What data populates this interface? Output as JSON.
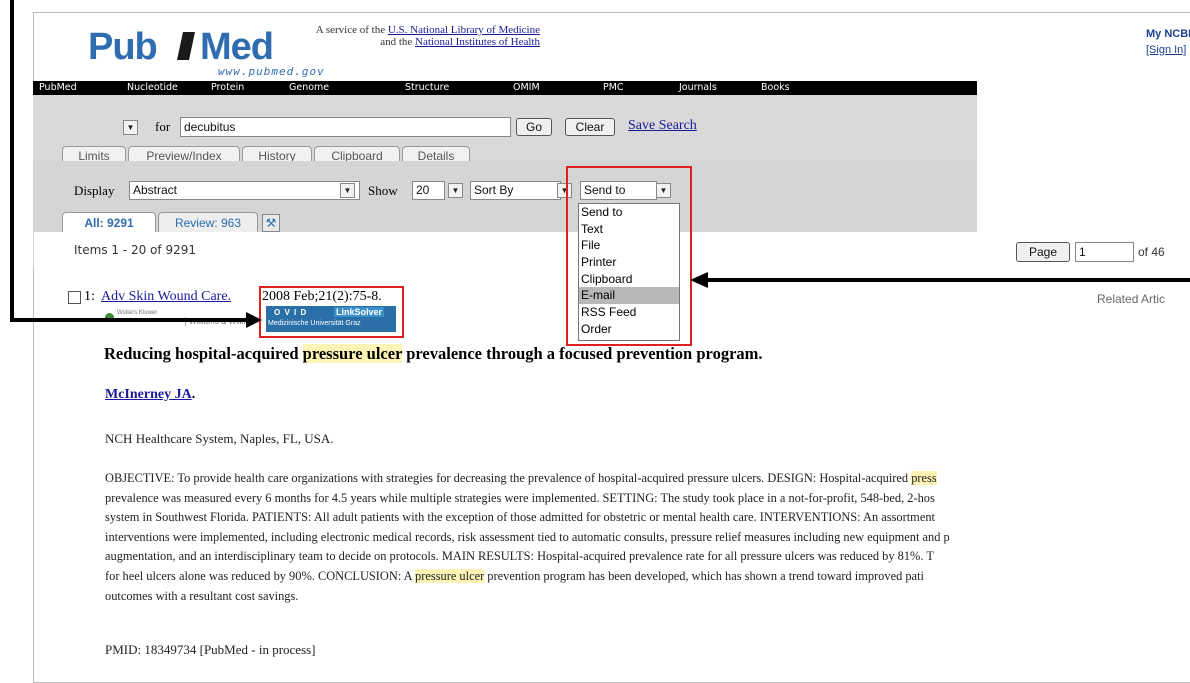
{
  "logo": {
    "pub": "Pub",
    "med": "Med",
    "www": "www.pubmed.gov"
  },
  "service": {
    "line1_prefix": "A service of the ",
    "line1_link": "U.S. National Library of Medicine",
    "line2_prefix": "and the ",
    "line2_link": "National Institutes of Health"
  },
  "account": {
    "title": "My NCBI",
    "signin": "[Sign In]"
  },
  "nav": [
    "PubMed",
    "Nucleotide",
    "Protein",
    "Genome",
    "Structure",
    "OMIM",
    "PMC",
    "Journals",
    "Books"
  ],
  "search": {
    "for_label": "for",
    "query": "decubitus",
    "go": "Go",
    "clear": "Clear",
    "save": "Save Search"
  },
  "tabs": [
    "Limits",
    "Preview/Index",
    "History",
    "Clipboard",
    "Details"
  ],
  "display": {
    "label": "Display",
    "value": "Abstract",
    "show_label": "Show",
    "show_value": "20",
    "sort": "Sort By",
    "sendto": "Send to"
  },
  "result_tabs": {
    "all": "All: 9291",
    "review": "Review: 963"
  },
  "items": "Items 1 - 20 of 9291",
  "pager": {
    "page_btn": "Page",
    "page_value": "1",
    "of": "of 46"
  },
  "sendto_menu": [
    "Send to",
    "Text",
    "File",
    "Printer",
    "Clipboard",
    "E-mail",
    "RSS Feed",
    "Order"
  ],
  "sendto_highlight": "E-mail",
  "result": {
    "number": "1:",
    "journal": "Adv Skin Wound Care.",
    "citation": "2008 Feb;21(2):75-8.",
    "related": "Related Artic",
    "publisher_logo": "Williams & Wilkins",
    "publisher_top": "Wolters Kluwer",
    "ovid": "O V I D",
    "linksolver": "LinkSolver",
    "graz": "Medizinische Universität Graz",
    "title_pre": "Reducing hospital-acquired ",
    "title_hl": "pressure ulcer",
    "title_post": " prevalence through a focused prevention program.",
    "author": "McInerney JA",
    "author_dot": ".",
    "affiliation": "NCH Healthcare System, Naples, FL, USA.",
    "abstract_1a": "OBJECTIVE: To provide health care organizations with strategies for decreasing the prevalence of hospital-acquired pressure ulcers. DESIGN: Hospital-acquired ",
    "abstract_1b": "press",
    "abstract_2": "prevalence was measured every 6 months for 4.5 years while multiple strategies were implemented. SETTING: The study took place in a not-for-profit, 548-bed, 2-hos",
    "abstract_3": "system in Southwest Florida. PATIENTS: All adult patients with the exception of those admitted for obstetric or mental health care. INTERVENTIONS: An assortment",
    "abstract_4": "interventions were implemented, including electronic medical records, risk assessment tied to automatic consults, pressure relief measures including new equipment and p",
    "abstract_5": "augmentation, and an interdisciplinary team to decide on protocols. MAIN RESULTS: Hospital-acquired prevalence rate for all pressure ulcers was reduced by 81%. T",
    "abstract_6a": "for heel ulcers alone was reduced by 90%. CONCLUSION: A ",
    "abstract_6b": "pressure ulcer",
    "abstract_6c": " prevention program has been developed, which has shown a trend toward improved pati",
    "abstract_7": "outcomes with a resultant cost savings.",
    "pmid": "PMID: 18349734 [PubMed - in process]"
  },
  "colors": {
    "highlight": "#fdf3b5",
    "annotation_red": "#e02020",
    "nav_bg": "#000000",
    "logo_blue": "#2f6db0"
  }
}
